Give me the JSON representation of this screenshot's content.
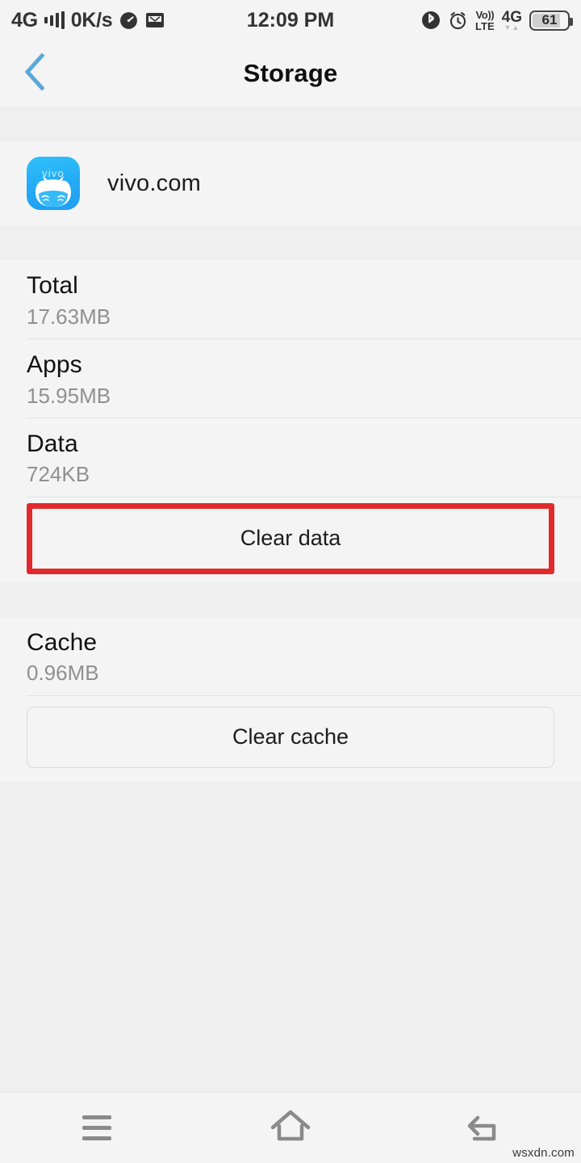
{
  "statusbar": {
    "network_type": "4G",
    "signal_icon": "signal-bars-icon",
    "data_rate": "0K/s",
    "speedometer_icon": "speedometer-icon",
    "mail_icon": "mail-icon",
    "time": "12:09 PM",
    "bluetooth_icon": "bluetooth-icon",
    "alarm_icon": "alarm-clock-icon",
    "volte_top": "Vo))",
    "volte_bottom": "LTE",
    "network_badge": "4G",
    "data_arrows": "▼▲",
    "battery_level": "61"
  },
  "header": {
    "back_icon": "back-chevron-icon",
    "title": "Storage",
    "accent_color": "#5ba8d8"
  },
  "app": {
    "icon_name": "vivo-app-icon",
    "icon_brand_text": "vivo",
    "name": "vivo.com"
  },
  "storage": {
    "rows": [
      {
        "label": "Total",
        "value": "17.63MB"
      },
      {
        "label": "Apps",
        "value": "15.95MB"
      },
      {
        "label": "Data",
        "value": "724KB"
      }
    ],
    "clear_data_label": "Clear data",
    "highlight_color": "#e22a2c"
  },
  "cache": {
    "label": "Cache",
    "value": "0.96MB",
    "clear_cache_label": "Clear cache"
  },
  "navbar": {
    "menu_icon": "menu-icon",
    "home_icon": "home-icon",
    "back_icon": "back-arrow-icon"
  },
  "watermark": "wsxdn.com"
}
